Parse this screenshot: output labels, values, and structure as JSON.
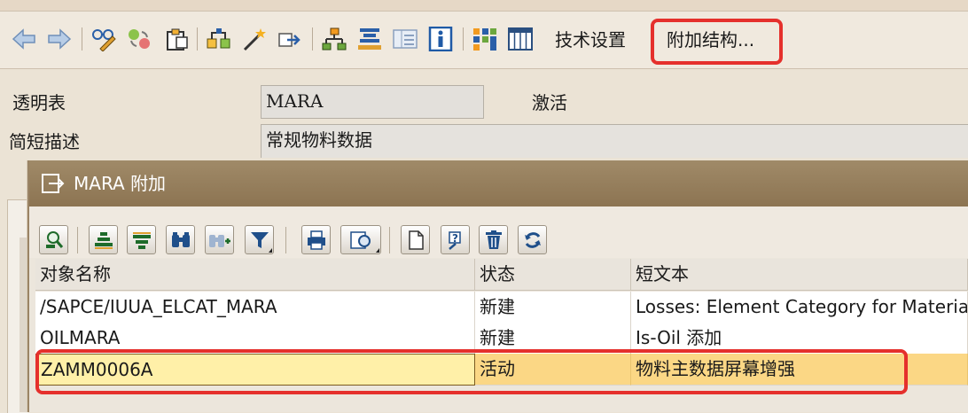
{
  "toolbar": {
    "icons": [
      "back-arrow-icon",
      "forward-arrow-icon",
      "glasses-pencil-icon",
      "switch-active-inactive-icon",
      "clipboard-icon",
      "where-used-icon",
      "magic-wand-icon",
      "export-arrow-icon",
      "hierarchy-icon",
      "list-stack-icon",
      "layout-icon",
      "info-icon",
      "structure-blocks-icon",
      "grid-table-icon"
    ],
    "tech_settings_label": "技术设置",
    "append_structures_label": "附加结构..."
  },
  "header": {
    "transparent_table_label": "透明表",
    "table_name": "MARA",
    "status": "激活",
    "short_desc_label": "简短描述",
    "short_desc_value": "常规物料数据"
  },
  "dialog": {
    "title": "MARA 附加",
    "toolbar_icons": [
      "choose-icon",
      "sort-ascending-icon",
      "sort-descending-icon",
      "find-icon",
      "find-next-icon",
      "filter-icon",
      "print-icon",
      "view-icon",
      "create-document-icon",
      "help-icon",
      "delete-icon",
      "refresh-icon"
    ],
    "columns": [
      "对象名称",
      "状态",
      "短文本"
    ],
    "rows": [
      {
        "name": "/SAPCE/IUUA_ELCAT_MARA",
        "status": "新建",
        "text": "Losses: Element Category for Material"
      },
      {
        "name": "OILMARA",
        "status": "新建",
        "text": "Is-Oil 添加"
      },
      {
        "name": "ZAMM0006A",
        "status": "活动",
        "text": "物料主数据屏幕增强"
      }
    ]
  },
  "colors": {
    "highlight_box": "#e5302c",
    "selected_row": "#fbd785",
    "title_bar": "#9a8262"
  }
}
